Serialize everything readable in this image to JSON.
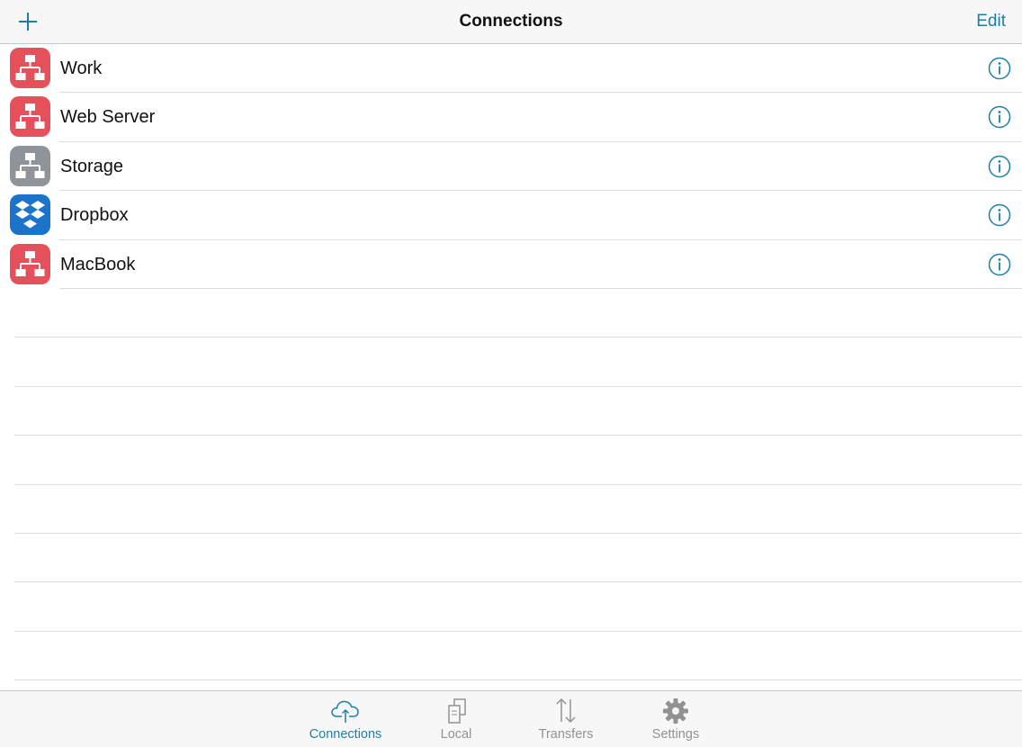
{
  "navbar": {
    "title": "Connections",
    "edit_label": "Edit",
    "add_icon": "plus-icon"
  },
  "connections": [
    {
      "label": "Work",
      "icon": "network-icon",
      "color": "#e5505b"
    },
    {
      "label": "Web Server",
      "icon": "network-icon",
      "color": "#e5505b"
    },
    {
      "label": "Storage",
      "icon": "network-icon",
      "color": "#8e9499"
    },
    {
      "label": "Dropbox",
      "icon": "dropbox-icon",
      "color": "#1b74c9"
    },
    {
      "label": "MacBook",
      "icon": "network-icon",
      "color": "#e5505b"
    }
  ],
  "tabs": [
    {
      "label": "Connections",
      "icon": "cloud-upload-icon",
      "active": true
    },
    {
      "label": "Local",
      "icon": "documents-icon",
      "active": false
    },
    {
      "label": "Transfers",
      "icon": "transfer-arrows-icon",
      "active": false
    },
    {
      "label": "Settings",
      "icon": "gear-icon",
      "active": false
    }
  ],
  "colors": {
    "accent": "#1d7fa8",
    "inactive_tab": "#929292",
    "separator": "#dcdcde"
  }
}
